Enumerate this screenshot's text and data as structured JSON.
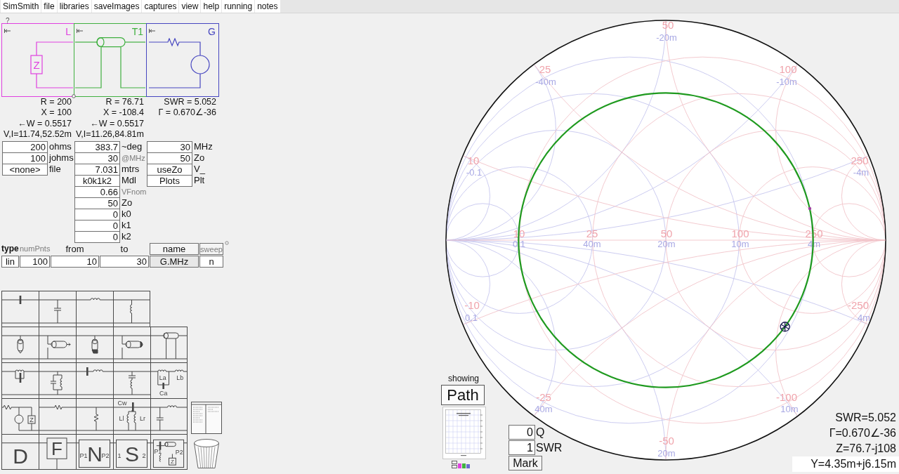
{
  "menu": [
    "SimSmith",
    "file",
    "libraries",
    "saveImages",
    "captures",
    "view",
    "help",
    "running",
    "notes"
  ],
  "help": "?",
  "circuit": {
    "elements": [
      {
        "kind": "load",
        "label": "L",
        "color": "#e040e0",
        "symbol": "Z",
        "readouts": [
          "R = 200",
          "X = 100",
          "←W = 0.5517",
          "V,I=11.74,52.52m"
        ]
      },
      {
        "kind": "line",
        "label": "T1",
        "color": "#40b040",
        "readouts": [
          "R = 76.71",
          "X = -108.4",
          "←W = 0.5517",
          "V,I=11.26,84.81m"
        ]
      },
      {
        "kind": "generator",
        "label": "G",
        "color": "#4646c0",
        "readouts": [
          "SWR = 5.052",
          "Γ = 0.670∠-36"
        ]
      }
    ]
  },
  "parameters": {
    "columns": [
      [
        {
          "kind": "input",
          "value": "200",
          "unit": "ohms",
          "dimmed": false
        },
        {
          "kind": "input",
          "value": "100",
          "unit": "johms",
          "dimmed": false
        },
        {
          "kind": "button",
          "value": "<none>",
          "unit": "file",
          "dimmed": false
        }
      ],
      [
        {
          "kind": "input",
          "value": "383.7",
          "unit": "~deg",
          "dimmed": false
        },
        {
          "kind": "input",
          "value": "30",
          "unit": "@MHz",
          "dimmed": true
        },
        {
          "kind": "input",
          "value": "7.031",
          "unit": "mtrs",
          "dimmed": false
        },
        {
          "kind": "button",
          "value": "k0k1k2",
          "unit": "Mdl",
          "dimmed": false
        },
        {
          "kind": "input",
          "value": "0.66",
          "unit": "VFnom",
          "dimmed": true
        },
        {
          "kind": "input",
          "value": "50",
          "unit": "Zo",
          "dimmed": false
        },
        {
          "kind": "input",
          "value": "0",
          "unit": "k0",
          "dimmed": false
        },
        {
          "kind": "input",
          "value": "0",
          "unit": "k1",
          "dimmed": false
        },
        {
          "kind": "input",
          "value": "0",
          "unit": "k2",
          "dimmed": false
        }
      ],
      [
        {
          "kind": "input",
          "value": "30",
          "unit": "MHz",
          "dimmed": false
        },
        {
          "kind": "input",
          "value": "50",
          "unit": "Zo",
          "dimmed": false
        },
        {
          "kind": "button",
          "value": "useZo",
          "unit": "V_",
          "dimmed": false
        },
        {
          "kind": "button",
          "value": "Plots",
          "unit": "Plt",
          "dimmed": false
        }
      ]
    ]
  },
  "sweep": {
    "columns": [
      {
        "header": {
          "kind": "bold",
          "text": "type"
        },
        "field": {
          "kind": "toggle",
          "text": "lin"
        }
      },
      {
        "header": {
          "kind": "hint",
          "text": "numPnts"
        },
        "field": {
          "kind": "input",
          "text": "100"
        }
      },
      {
        "header": {
          "kind": "plain",
          "text": "from"
        },
        "field": {
          "kind": "input",
          "text": "10"
        }
      },
      {
        "header": {
          "kind": "plain",
          "text": "to"
        },
        "field": {
          "kind": "input",
          "text": "30"
        }
      },
      {
        "header": {
          "kind": "boxed",
          "text": "name"
        },
        "field": {
          "kind": "selector",
          "text": "G.MHz"
        }
      },
      {
        "header": {
          "kind": "boxedhint",
          "text": "sweep"
        },
        "field": {
          "kind": "toggle",
          "text": "n"
        }
      }
    ]
  },
  "palette": {
    "rows": [
      [
        {
          "kind": "seriesCap"
        },
        {
          "kind": "shuntCap"
        },
        {
          "kind": "seriesInd"
        },
        {
          "kind": "shuntInd"
        }
      ],
      [
        {
          "kind": "shuntOpenStub"
        },
        {
          "kind": "seriesOpenStub"
        },
        {
          "kind": "shuntShortStub"
        },
        {
          "kind": "seriesShortStub"
        },
        {
          "kind": "line"
        }
      ],
      [
        {
          "kind": "tank"
        },
        {
          "kind": "shuntTank"
        },
        {
          "kind": "seriesLC"
        },
        {
          "kind": "shuntLC"
        },
        {
          "kind": "transformer",
          "labels": [
            "La",
            "Lb",
            "Ca"
          ]
        }
      ],
      [
        {
          "kind": "source",
          "labels": [
            "Z"
          ]
        },
        {
          "kind": "seriesRes"
        },
        {
          "kind": "shuntRes"
        },
        {
          "kind": "crystal",
          "labels": [
            "Cw",
            "Ll",
            "Lr"
          ]
        },
        {
          "kind": "lowpass"
        }
      ],
      [
        {
          "kind": "data",
          "labels": [
            "D"
          ]
        },
        {
          "kind": "file",
          "labels": [
            "F"
          ]
        },
        {
          "kind": "network",
          "labels": [
            "P1",
            "N",
            "P2"
          ]
        },
        {
          "kind": "sparam",
          "labels": [
            "1",
            "S",
            "2"
          ]
        },
        {
          "kind": "block",
          "labels": [
            "P1",
            "P2",
            "Z"
          ]
        }
      ]
    ]
  },
  "smith_chart": {
    "rim_labels": [
      {
        "reactance": "50",
        "susceptance": "-20m"
      },
      {
        "reactance": "25",
        "susceptance": "-40m"
      },
      {
        "reactance": "100",
        "susceptance": "-10m"
      },
      {
        "reactance": "10",
        "susceptance": "-0.1"
      },
      {
        "reactance": "250",
        "susceptance": "-4m"
      },
      {
        "reactance": "-10",
        "susceptance": "0.1"
      },
      {
        "reactance": "-250",
        "susceptance": "4m"
      },
      {
        "reactance": "-25",
        "susceptance": "40m"
      },
      {
        "reactance": "-100",
        "susceptance": "10m"
      },
      {
        "reactance": "-50",
        "susceptance": "20m"
      }
    ],
    "axis_labels": [
      {
        "resistance": "10",
        "conductance": "0.1"
      },
      {
        "resistance": "25",
        "conductance": "40m"
      },
      {
        "resistance": "50",
        "conductance": "20m"
      },
      {
        "resistance": "100",
        "conductance": "10m"
      },
      {
        "resistance": "250",
        "conductance": "4m"
      }
    ]
  },
  "display": {
    "caption": "showing",
    "mode": "Path"
  },
  "marker": {
    "fields": [
      {
        "value": "0",
        "suffix": "Q"
      },
      {
        "value": "1",
        "suffix": "SWR"
      }
    ],
    "button": "Mark"
  },
  "readouts": [
    {
      "text": "SWR=5.052",
      "highlighted": false
    },
    {
      "text": "Γ=0.670∠-36",
      "highlighted": false
    },
    {
      "text": "Z=76.7-j108",
      "highlighted": false
    },
    {
      "text": "Y=4.35m+j6.15m",
      "highlighted": true
    }
  ]
}
